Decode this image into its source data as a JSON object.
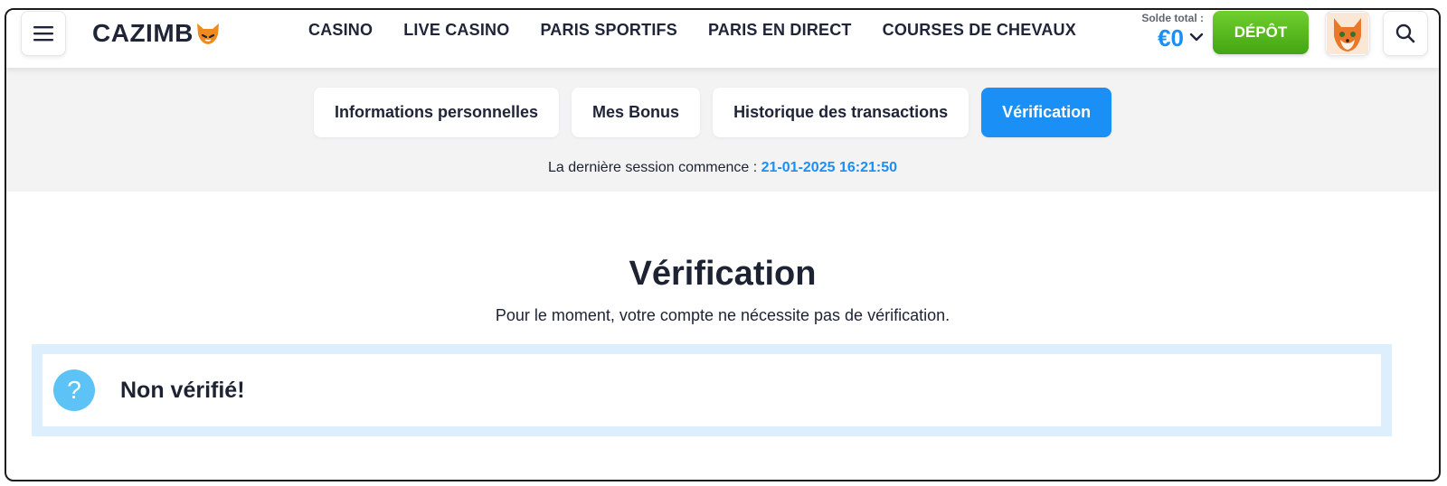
{
  "header": {
    "logo_text": "CAZIMB",
    "nav": [
      "CASINO",
      "LIVE CASINO",
      "PARIS SPORTIFS",
      "PARIS EN DIRECT",
      "COURSES DE CHEVAUX"
    ],
    "balance_label": "Solde total :",
    "balance_value": "€0",
    "deposit_label": "DÉPÔT",
    "icons": [
      "menu-icon",
      "fox-logo-icon",
      "chevron-down-icon",
      "avatar",
      "search-icon"
    ]
  },
  "tabs": [
    {
      "label": "Informations personnelles",
      "active": false
    },
    {
      "label": "Mes Bonus",
      "active": false
    },
    {
      "label": "Historique des transactions",
      "active": false
    },
    {
      "label": "Vérification",
      "active": true
    }
  ],
  "session": {
    "label": "La dernière session commence : ",
    "date": "21-01-2025 16:21:50"
  },
  "verification": {
    "title": "Vérification",
    "subtitle": "Pour le moment, votre compte ne nécessite pas de vérification.",
    "status_icon": "?",
    "status_text": "Non vérifié!"
  },
  "colors": {
    "accent": "#1a8ff5",
    "deposit": "#4cb31a",
    "status_border": "#ddeffc",
    "question_icon": "#5dc3f7"
  }
}
